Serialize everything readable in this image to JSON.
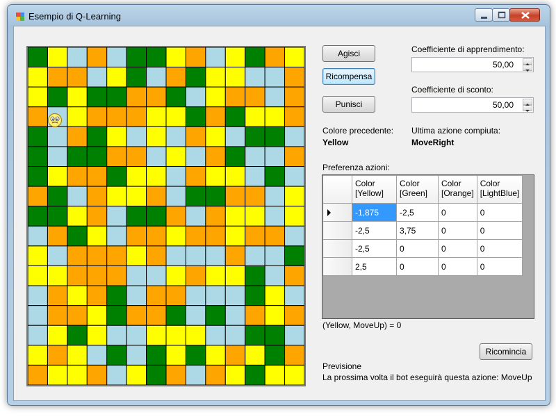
{
  "window": {
    "title": "Esempio di Q-Learning"
  },
  "buttons": {
    "act": "Agisci",
    "reward": "Ricompensa",
    "punish": "Punisci",
    "restart": "Ricomincia"
  },
  "learning_rate": {
    "label": "Coefficiente di apprendimento:",
    "value": "50,00"
  },
  "discount": {
    "label": "Coefficiente di sconto:",
    "value": "50,00"
  },
  "previous_color": {
    "label": "Colore precedente:",
    "value": "Yellow"
  },
  "last_action": {
    "label": "Ultima azione compiuta:",
    "value": "MoveRight"
  },
  "preferences": {
    "label": "Preferenza azioni:",
    "columns": [
      "Color [Yellow]",
      "Color [Green]",
      "Color [Orange]",
      "Color [LightBlue]"
    ],
    "rows": [
      [
        "-1,875",
        "-2,5",
        "0",
        "0"
      ],
      [
        "-2,5",
        "3,75",
        "0",
        "0"
      ],
      [
        "-2,5",
        "0",
        "0",
        "0"
      ],
      [
        "2,5",
        "0",
        "0",
        "0"
      ]
    ]
  },
  "q_value_text": "(Yellow, MoveUp) = 0",
  "prediction": {
    "title": "Previsione",
    "text": "La prossima volta il bot eseguirà questa azione: MoveUp"
  },
  "colors": {
    "Y": "#ffff00",
    "G": "#008000",
    "O": "#ffa500",
    "L": "#add8e6"
  },
  "grid": [
    "GYLOLGGYOLYGOY",
    "YOOLYGLOGYYLLO",
    "YGYGGOOGLYOOLO",
    "OLYOOOYYGOGYYO",
    "GLOGYLYLOYLGGL",
    "GLGGOOLYLOGLLO",
    "GYOOGYYLOYYLGL",
    "OGLOYYOLGGOOLY",
    "GGYOLGGOLOYYLY",
    "LOGYLOOYOOYOOL",
    "YLOOOYOLLLOLLG",
    "YYOOOLLYOYYGLO",
    "LOYOGLOOLLLGYL",
    "LOOYGOOGLGLOYO",
    "LYGYLLYYYLLGGL",
    "YOYLGLGYGYOYGO",
    "OYYOLYGOLOYGYY"
  ]
}
